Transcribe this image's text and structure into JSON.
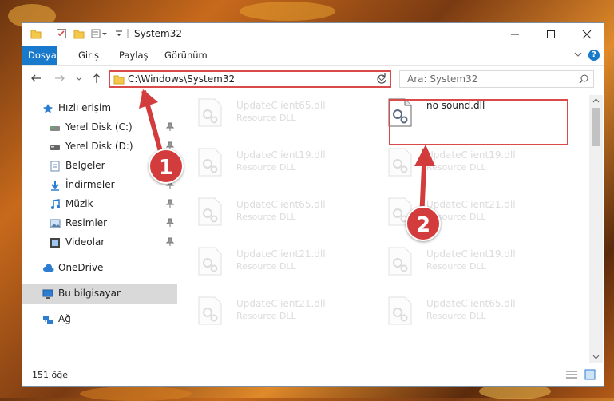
{
  "window": {
    "title": "System32"
  },
  "ribbon": {
    "tabs": [
      "Dosya",
      "Giriş",
      "Paylaş",
      "Görünüm"
    ],
    "help": "?"
  },
  "navigation": {
    "address": "C:\\Windows\\System32",
    "search_placeholder": "Ara: System32"
  },
  "sidebar": {
    "items": [
      {
        "label": "Hızlı erişim",
        "icon": "star-icon"
      },
      {
        "label": "Yerel Disk (C:)",
        "icon": "drive-icon"
      },
      {
        "label": "Yerel Disk (D:)",
        "icon": "drive-icon"
      },
      {
        "label": "Belgeler",
        "icon": "documents-icon"
      },
      {
        "label": "İndirmeler",
        "icon": "download-icon"
      },
      {
        "label": "Müzik",
        "icon": "music-icon"
      },
      {
        "label": "Resimler",
        "icon": "pictures-icon"
      },
      {
        "label": "Videolar",
        "icon": "videos-icon"
      },
      {
        "label": "OneDrive",
        "icon": "cloud-icon"
      },
      {
        "label": "Bu bilgisayar",
        "icon": "computer-icon"
      },
      {
        "label": "Ağ",
        "icon": "network-icon"
      }
    ]
  },
  "files": [
    {
      "name": "UpdateClient65.dll",
      "desc": "Resource DLL"
    },
    {
      "name": "no sound.dll",
      "desc": ""
    },
    {
      "name": "UpdateClient19.dll",
      "desc": "Resource DLL"
    },
    {
      "name": "UpdateClient19.dll",
      "desc": "Resource DLL"
    },
    {
      "name": "UpdateClient65.dll",
      "desc": "Resource DLL"
    },
    {
      "name": "UpdateClient21.dll",
      "desc": "Resource DLL"
    },
    {
      "name": "UpdateClient21.dll",
      "desc": "Resource DLL"
    },
    {
      "name": "UpdateClient19.dll",
      "desc": "Resource DLL"
    },
    {
      "name": "UpdateClient21.dll",
      "desc": "Resource DLL"
    },
    {
      "name": "UpdateClient65.dll",
      "desc": "Resource DLL"
    }
  ],
  "status": {
    "count": "151 öğe"
  },
  "callouts": [
    "1",
    "2"
  ],
  "colors": {
    "accent": "#1979ca",
    "highlight": "#d94a4a",
    "callout": "#d23c3c"
  }
}
